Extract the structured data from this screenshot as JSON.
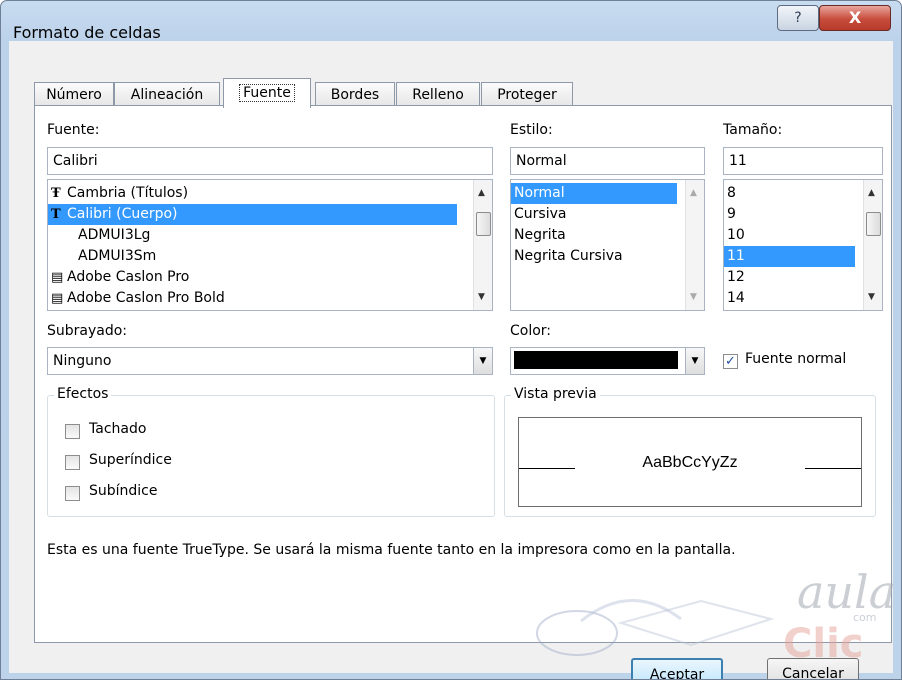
{
  "window": {
    "title": "Formato de celdas",
    "help_label": "?",
    "close_label": "X"
  },
  "tabs": [
    {
      "label": "Número"
    },
    {
      "label": "Alineación"
    },
    {
      "label": "Fuente"
    },
    {
      "label": "Bordes"
    },
    {
      "label": "Relleno"
    },
    {
      "label": "Proteger"
    }
  ],
  "font": {
    "label": "Fuente:",
    "value": "Calibri",
    "items": [
      {
        "label": "Cambria (Títulos)",
        "icon": "truetype-icon"
      },
      {
        "label": "Calibri (Cuerpo)",
        "icon": "truetype-icon"
      },
      {
        "label": "ADMUI3Lg",
        "icon": ""
      },
      {
        "label": "ADMUI3Sm",
        "icon": ""
      },
      {
        "label": "Adobe Caslon Pro",
        "icon": "opentype-icon"
      },
      {
        "label": "Adobe Caslon Pro Bold",
        "icon": "opentype-icon"
      }
    ],
    "selected_index": 1
  },
  "style": {
    "label": "Estilo:",
    "value": "Normal",
    "items": [
      "Normal",
      "Cursiva",
      "Negrita",
      "Negrita Cursiva"
    ],
    "selected_index": 0
  },
  "size": {
    "label": "Tamaño:",
    "value": "11",
    "items": [
      "8",
      "9",
      "10",
      "11",
      "12",
      "14"
    ],
    "selected_index": 3
  },
  "underline": {
    "label": "Subrayado:",
    "value": "Ninguno"
  },
  "color": {
    "label": "Color:",
    "value": "#000000"
  },
  "normal_font": {
    "label": "Fuente normal",
    "checked": true
  },
  "effects": {
    "title": "Efectos",
    "items": [
      {
        "label": "Tachado",
        "checked": false
      },
      {
        "label": "Superíndice",
        "checked": false
      },
      {
        "label": "Subíndice",
        "checked": false
      }
    ]
  },
  "preview": {
    "title": "Vista previa",
    "sample": "AaBbCcYyZz"
  },
  "info_text": "Esta es una fuente TrueType. Se usará la misma fuente tanto en la impresora como en la pantalla.",
  "buttons": {
    "ok": "Aceptar",
    "cancel": "Cancelar"
  },
  "watermark": {
    "line1": "aula",
    "line2": "Clic",
    "small": "com"
  },
  "colors": {
    "selection": "#3399ff",
    "title_bar": "#bcd2ea",
    "close_button": "#c74c3c"
  }
}
